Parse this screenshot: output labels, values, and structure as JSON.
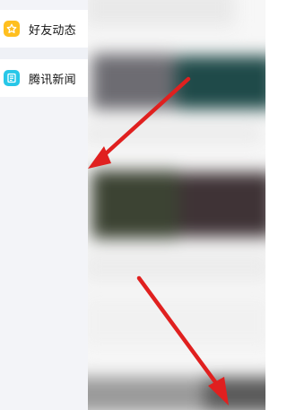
{
  "drawer": {
    "items": [
      {
        "label": "好友动态",
        "icon": "star-icon",
        "color": "#ffbf1f"
      },
      {
        "label": "腾讯新闻",
        "icon": "news-icon",
        "color": "#27c7e8"
      }
    ]
  },
  "colors": {
    "drawer_bg": "#f3f4f8",
    "annotation_arrow": "#e0201f"
  }
}
